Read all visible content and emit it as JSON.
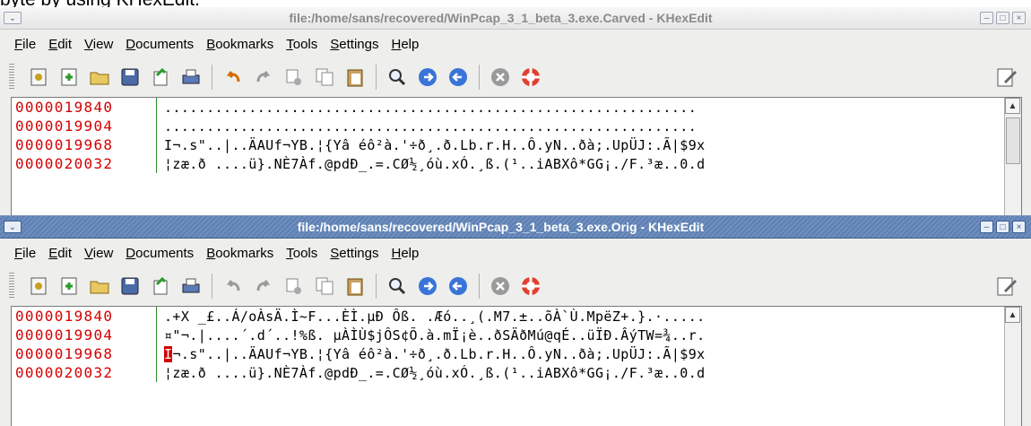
{
  "caption": "byte by using KHexEdit.",
  "windows": [
    {
      "title": "file:/home/sans/recovered/WinPcap_3_1_beta_3.exe.Carved - KHexEdit",
      "menu": [
        "File",
        "Edit",
        "View",
        "Documents",
        "Bookmarks",
        "Tools",
        "Settings",
        "Help"
      ],
      "rows": [
        {
          "offset": "0000019840",
          "chars": "..............................................................."
        },
        {
          "offset": "0000019904",
          "chars": "..............................................................."
        },
        {
          "offset": "0000019968",
          "chars": "I¬.s\"..|..ÄAUf¬YB.¦{Yâ éô²à.'÷ð¸.ð.Lb.r.H..Ô.yN..ðà;.UpÜJ:.Ã|$9x"
        },
        {
          "offset": "0000020032",
          "chars": "¦zæ.ð ....ü}.NÈ7Àf.@pdÐ_.=.CØ½¸óù.xÓ.¸ß.(¹..iABXô*GG¡./F.³æ..0.d"
        }
      ]
    },
    {
      "title": "file:/home/sans/recovered/WinPcap_3_1_beta_3.exe.Orig - KHexEdit",
      "menu": [
        "File",
        "Edit",
        "View",
        "Documents",
        "Bookmarks",
        "Tools",
        "Settings",
        "Help"
      ],
      "rows": [
        {
          "offset": "0000019840",
          "chars": ".+X _£..Á/oÀsÄ.Ì~F...ÈÌ.µÐ Ôß. .Æó..¸(.M7.±..õÀ`Ù.MpëZ+.}.·....."
        },
        {
          "offset": "0000019904",
          "chars": "¤\"¬.|....´.d´..!%ß. µÀÌÙ$jÔS¢Õ.à.mÏ¡è..ðSÄðMú@qÉ..üÏÐ.ÂýTW=¾..r."
        },
        {
          "cursor": "I",
          "offset": "0000019968",
          "chars": "¬.s\"..|..ÄAUf¬YB.¦{Yâ éô²à.'÷ð¸.ð.Lb.r.H..Ô.yN..ðà;.UpÜJ:.Ã|$9x"
        },
        {
          "offset": "0000020032",
          "chars": "¦zæ.ð ....ü}.NÈ7Àf.@pdÐ_.=.CØ½¸óù.xÓ.¸ß.(¹..iABXô*GG¡./F.³æ..0.d"
        }
      ]
    }
  ],
  "icons": {
    "toolbar": [
      "document-properties-icon",
      "new-document-icon",
      "open-folder-icon",
      "save-icon",
      "export-icon",
      "print-icon",
      "undo-icon",
      "redo-icon",
      "cut-icon",
      "copy-icon",
      "paste-icon",
      "find-icon",
      "forward-icon",
      "back-icon",
      "stop-icon",
      "help-icon",
      "edit-pen-icon"
    ],
    "glyphs": {
      "sys": "⌄",
      "min": "–",
      "max": "□",
      "close": "×",
      "scroll_up": "▲"
    }
  },
  "colors": {
    "offset_text": "#d40000",
    "offset_divider": "#2a8a2a",
    "active_titlebar": "#6f8fbf",
    "cursor_bg": "#d40000"
  }
}
